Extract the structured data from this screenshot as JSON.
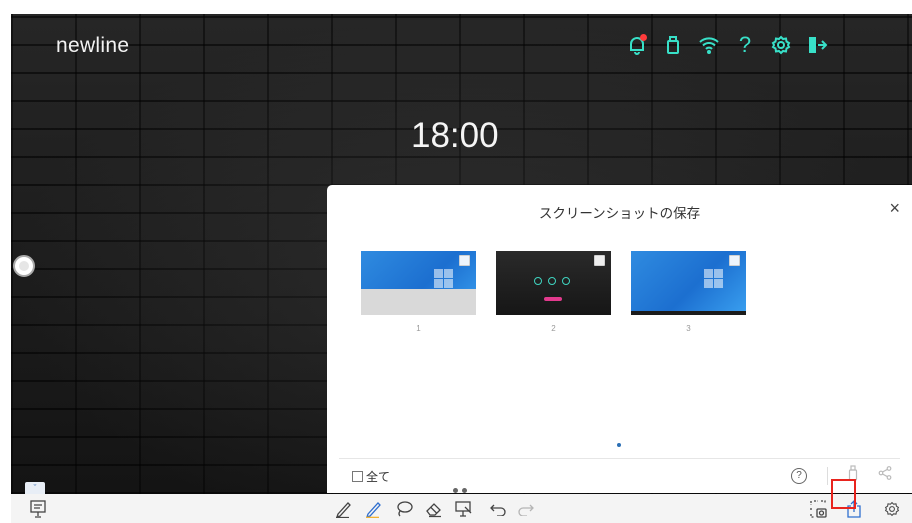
{
  "screen": {
    "logo": "newline",
    "clock": "18:00"
  },
  "top_icons": [
    "bell-icon",
    "usb-icon",
    "wifi-icon",
    "help-icon",
    "settings-icon",
    "exit-icon"
  ],
  "dialog": {
    "title": "スクリーンショットの保存",
    "close_label": "×",
    "thumbnails": [
      {
        "caption": "1",
        "style": "windows-desktop"
      },
      {
        "caption": "2",
        "style": "newline-home"
      },
      {
        "caption": "3",
        "style": "windows-desktop"
      }
    ],
    "select_all_label": "全て",
    "help_label": "?"
  },
  "toolbar": {
    "collapse_label": "ˇ",
    "left_icons": [
      "presentation-icon"
    ],
    "tools": [
      "pen-icon",
      "highlighter-icon",
      "lasso-icon",
      "eraser-icon",
      "whiteboard-icon",
      "undo-icon",
      "redo-icon"
    ],
    "right_icons": [
      "screenshot-icon",
      "share-upload-icon",
      "settings-icon"
    ],
    "highlighted": "share-upload-icon"
  },
  "colors": {
    "accent_teal": "#38e0c8",
    "notification_red": "#ff3b3b",
    "highlight_red": "#e8241e",
    "active_blue": "#2f6fcf"
  }
}
